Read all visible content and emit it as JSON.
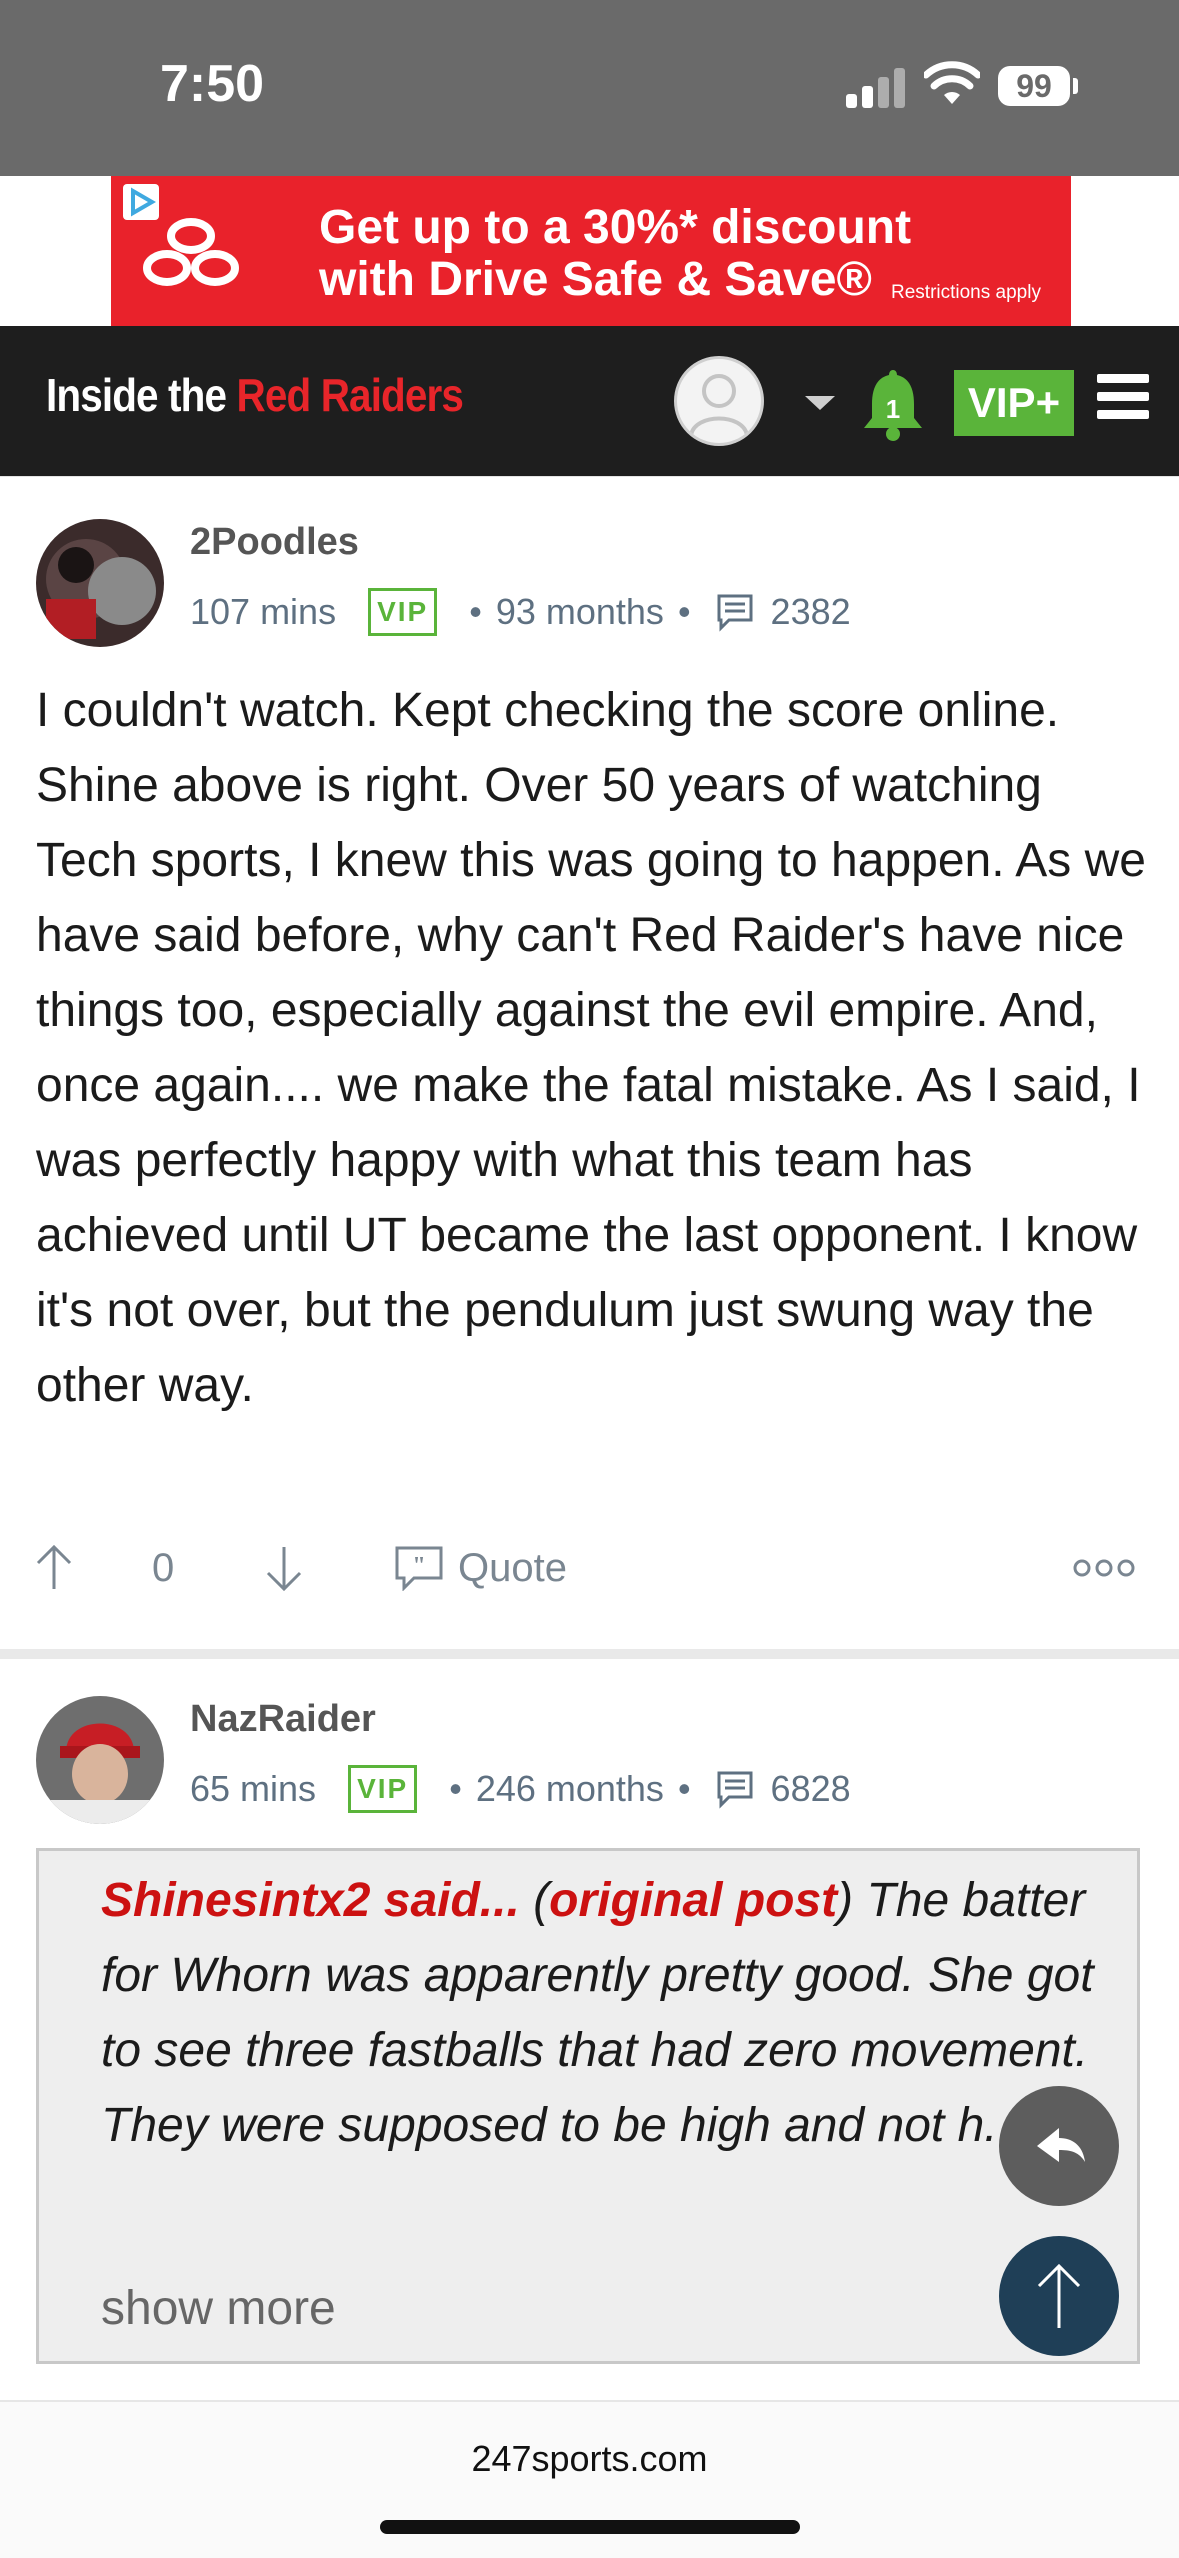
{
  "status": {
    "time": "7:50",
    "battery": "99"
  },
  "ad": {
    "line1": "Get up to a 30%* discount",
    "line2": "with Drive Safe & Save®",
    "fine": "Restrictions apply"
  },
  "nav": {
    "brand_white": "Inside the ",
    "brand_red": "Red Raiders",
    "notifications": "1",
    "vip": "VIP+"
  },
  "posts": [
    {
      "user": "2Poodles",
      "time": "107 mins",
      "badge": "VIP",
      "tenure": "93 months",
      "count": "2382",
      "body": "I couldn't watch. Kept checking the score online. Shine above is right. Over 50 years of watching Tech sports, I knew this was going to happen. As we have said before, why can't Red Raider's have nice things too, especially against the evil empire. And, once again.... we make the fatal mistake. As I said, I was perfectly happy with what this team has achieved until UT became the last opponent. I know it's not over, but the pendulum just swung way the other way.",
      "votes": "0",
      "quote_label": "Quote"
    },
    {
      "user": "NazRaider",
      "time": "65 mins",
      "badge": "VIP",
      "tenure": "246 months",
      "count": "6828",
      "quote": {
        "author": "Shinesintx2 said...",
        "open_paren": " (",
        "link": "original post",
        "close": ")",
        "text": " The batter for Whorn was apparently pretty good. She got to see three fastballs that had zero movement. They were supposed to be high and not h...",
        "show_more": "show more"
      }
    }
  ],
  "footer": {
    "url": "247sports.com"
  },
  "colors": {
    "brand_red": "#e8252a",
    "vip_green": "#5ab43a",
    "quote_red": "#cc1111",
    "fab_dark": "#1f3f57"
  }
}
